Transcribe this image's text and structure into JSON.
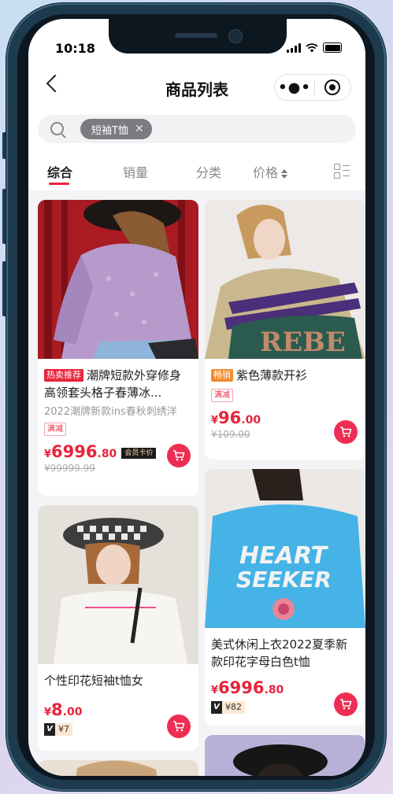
{
  "status_bar": {
    "time": "10:18"
  },
  "navbar": {
    "title": "商品列表",
    "more_glyph": "•●•"
  },
  "search": {
    "chip_label": "短袖T恤",
    "chip_close": "✕"
  },
  "tabs": [
    {
      "label": "综合",
      "active": true
    },
    {
      "label": "销量",
      "active": false
    },
    {
      "label": "分类",
      "active": false
    },
    {
      "label": "价格",
      "active": false
    }
  ],
  "products": [
    {
      "badge": "热卖推荐",
      "badge_color": "#e8243c",
      "title": "潮牌短款外穿修身高领套头格子春薄冰...",
      "subtitle": "2022潮牌新款ins春秋刺绣洋",
      "promo_tag": "满减",
      "price_currency": "¥",
      "price_int": "6996",
      "price_dec": ".80",
      "member_label": "会员卡价",
      "old_price": "¥99999.99"
    },
    {
      "badge": "畅销",
      "badge_color": "#f28a2c",
      "title": "紫色薄款开衫",
      "promo_tag": "满减",
      "price_currency": "¥",
      "price_int": "96",
      "price_dec": ".00",
      "old_price": "¥109.00"
    },
    {
      "title": "个性印花短袖t恤女",
      "price_currency": "¥",
      "price_int": "8",
      "price_dec": ".00",
      "vip_icon": "V",
      "vip_price": "¥7"
    },
    {
      "title": "美式休闲上衣2022夏季新款印花字母白色t恤",
      "price_currency": "¥",
      "price_int": "6996",
      "price_dec": ".80",
      "vip_icon": "V",
      "vip_price": "¥82"
    }
  ],
  "artwork": {
    "card4_print_line1": "HEART",
    "card4_print_line2": "SEEKER",
    "card2_sweater_text": "REBE"
  },
  "colors": {
    "accent": "#e8243c",
    "cart": "#ee2d52",
    "frame": "#1d3a4f"
  },
  "icons": [
    "back-chevron-icon",
    "more-dots-icon",
    "miniapp-close-icon",
    "search-icon",
    "sort-arrows-icon",
    "layout-toggle-icon",
    "cart-icon",
    "signal-icon",
    "wifi-icon",
    "battery-icon"
  ]
}
